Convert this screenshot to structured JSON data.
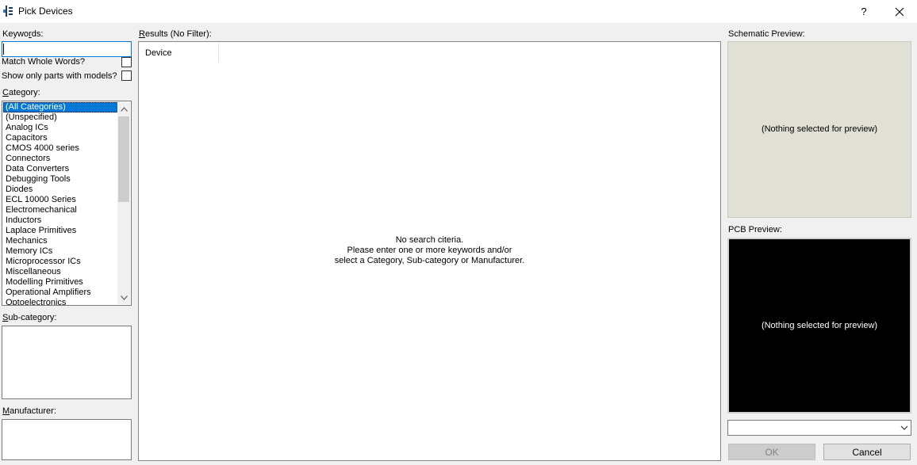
{
  "window": {
    "title": "Pick Devices",
    "help_label": "?",
    "close_label": "✕"
  },
  "keywords": {
    "label_pre": "Keywo",
    "label_key": "r",
    "label_post": "ds:",
    "value": ""
  },
  "options": {
    "match_whole_words": "Match Whole Words?",
    "show_models": "Show only parts with models?"
  },
  "category": {
    "label_key": "C",
    "label_post": "ategory:",
    "items": [
      "(All Categories)",
      "(Unspecified)",
      "Analog ICs",
      "Capacitors",
      "CMOS 4000 series",
      "Connectors",
      "Data Converters",
      "Debugging Tools",
      "Diodes",
      "ECL 10000 Series",
      "Electromechanical",
      "Inductors",
      "Laplace Primitives",
      "Mechanics",
      "Memory ICs",
      "Microprocessor ICs",
      "Miscellaneous",
      "Modelling Primitives",
      "Operational Amplifiers",
      "Optoelectronics"
    ],
    "selected_index": 0
  },
  "subcategory": {
    "label_key": "S",
    "label_post": "ub-category:"
  },
  "manufacturer": {
    "label_key": "M",
    "label_post": "anufacturer:"
  },
  "results": {
    "label_key": "R",
    "label_post": "esults (No Filter):",
    "column_device": "Device",
    "message_line1": "No search citeria.",
    "message_line2": "Please enter one or more keywords and/or",
    "message_line3": "select a Category, Sub-category or Manufacturer."
  },
  "schematic_preview": {
    "label": "Schematic Preview:",
    "message": "(Nothing selected for preview)"
  },
  "pcb_preview": {
    "label": "PCB Preview:",
    "message": "(Nothing selected for preview)"
  },
  "buttons": {
    "ok": "OK",
    "cancel": "Cancel"
  }
}
